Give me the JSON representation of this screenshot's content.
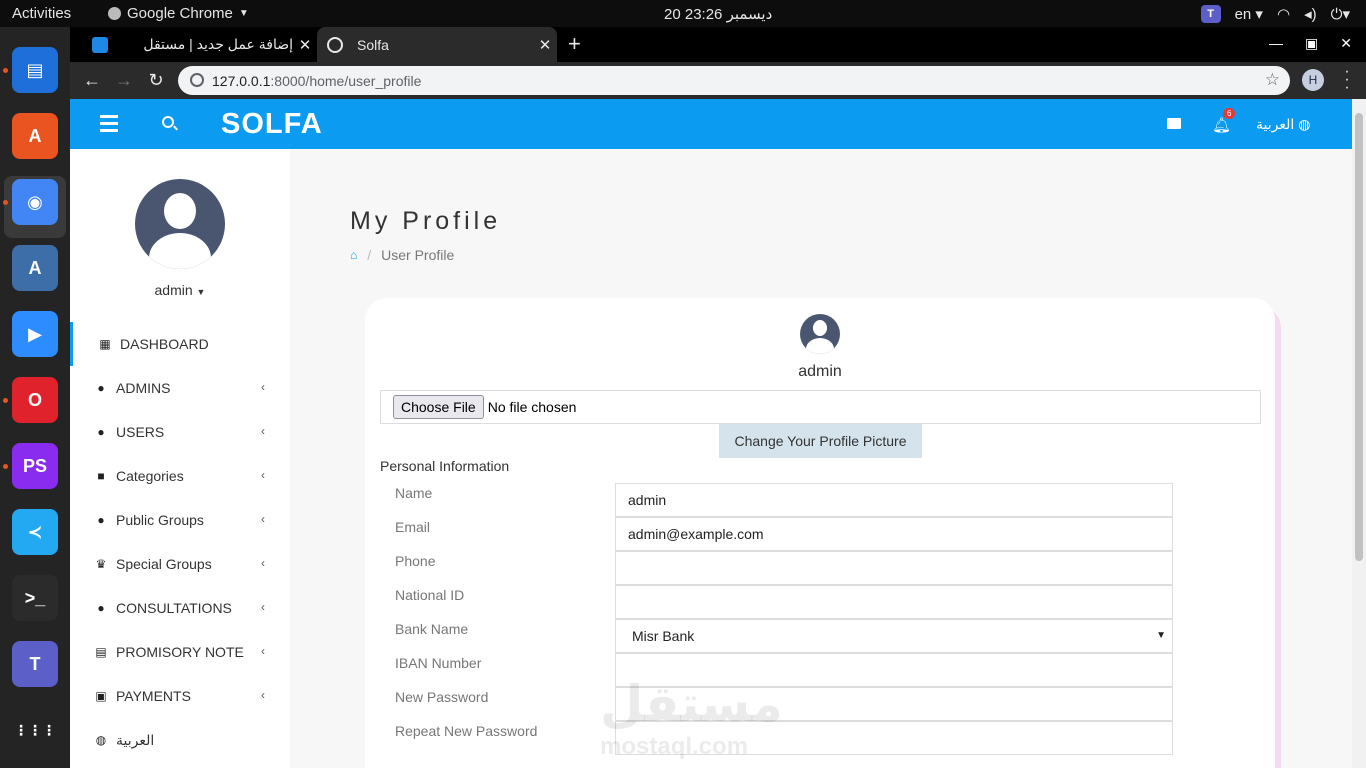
{
  "os": {
    "activities": "Activities",
    "app_name": "Google Chrome",
    "clock": "20 ديسمبر  23:26",
    "lang": "en"
  },
  "dock": [
    {
      "name": "document-viewer-icon",
      "color": "#1e6fd9",
      "glyph": "▤"
    },
    {
      "name": "software-store-icon",
      "color": "#e95420",
      "glyph": "A"
    },
    {
      "name": "chrome-icon",
      "color": "#4285f4",
      "glyph": "◉"
    },
    {
      "name": "android-studio-icon",
      "color": "#3d6ea8",
      "glyph": "A"
    },
    {
      "name": "zoom-icon",
      "color": "#2d8cff",
      "glyph": "▶"
    },
    {
      "name": "opera-icon",
      "color": "#e0222d",
      "glyph": "O"
    },
    {
      "name": "phpstorm-icon",
      "color": "#8a2bf0",
      "glyph": "PS"
    },
    {
      "name": "vscode-icon",
      "color": "#23a9f2",
      "glyph": "≺"
    },
    {
      "name": "terminal-icon",
      "color": "#2b2b2b",
      "glyph": ">_"
    },
    {
      "name": "teams-icon",
      "color": "#5b5fc7",
      "glyph": "T"
    },
    {
      "name": "app-grid-icon",
      "color": "transparent",
      "glyph": "⋮⋮⋮"
    }
  ],
  "browser": {
    "tabs": [
      {
        "title": "إضافة عمل جديد | مستقل"
      },
      {
        "title": "Solfa"
      }
    ],
    "url_host": "127.0.0.1",
    "url_path": ":8000/home/user_profile",
    "profile_initial": "H"
  },
  "header": {
    "brand": "SOLFA",
    "notification_count": "6",
    "language": "العربية"
  },
  "sidebar": {
    "username": "admin",
    "items": [
      {
        "label": "DASHBOARD",
        "icon": "▦",
        "chevron": false
      },
      {
        "label": "ADMINS",
        "icon": "●",
        "chevron": true
      },
      {
        "label": "USERS",
        "icon": "●",
        "chevron": true
      },
      {
        "label": "Categories",
        "icon": "■",
        "chevron": true
      },
      {
        "label": "Public Groups",
        "icon": "●",
        "chevron": true
      },
      {
        "label": "Special Groups",
        "icon": "♛",
        "chevron": true
      },
      {
        "label": "CONSULTATIONS",
        "icon": "●",
        "chevron": true
      },
      {
        "label": "PROMISORY NOTE",
        "icon": "▤",
        "chevron": true
      },
      {
        "label": "PAYMENTS",
        "icon": "▣",
        "chevron": true
      },
      {
        "label": "العربية",
        "icon": "◍",
        "chevron": false
      }
    ]
  },
  "main": {
    "title": "My Profile",
    "breadcrumb_current": "User Profile",
    "profile_name": "admin",
    "file_button": "Choose File",
    "file_status": "No file chosen",
    "change_picture": "Change Your Profile Picture",
    "section_title": "Personal Information",
    "fields": [
      {
        "label": "Name",
        "value": "admin",
        "type": "text"
      },
      {
        "label": "Email",
        "value": "admin@example.com",
        "type": "text"
      },
      {
        "label": "Phone",
        "value": "",
        "type": "text"
      },
      {
        "label": "National ID",
        "value": "",
        "type": "text"
      },
      {
        "label": "Bank Name",
        "value": "Misr Bank",
        "type": "select"
      },
      {
        "label": "IBAN Number",
        "value": "",
        "type": "text"
      },
      {
        "label": "New Password",
        "value": "",
        "type": "password"
      },
      {
        "label": "Repeat New Password",
        "value": "",
        "type": "password"
      }
    ]
  },
  "watermark": {
    "arabic": "مستقل",
    "latin": "mostaql.com"
  }
}
